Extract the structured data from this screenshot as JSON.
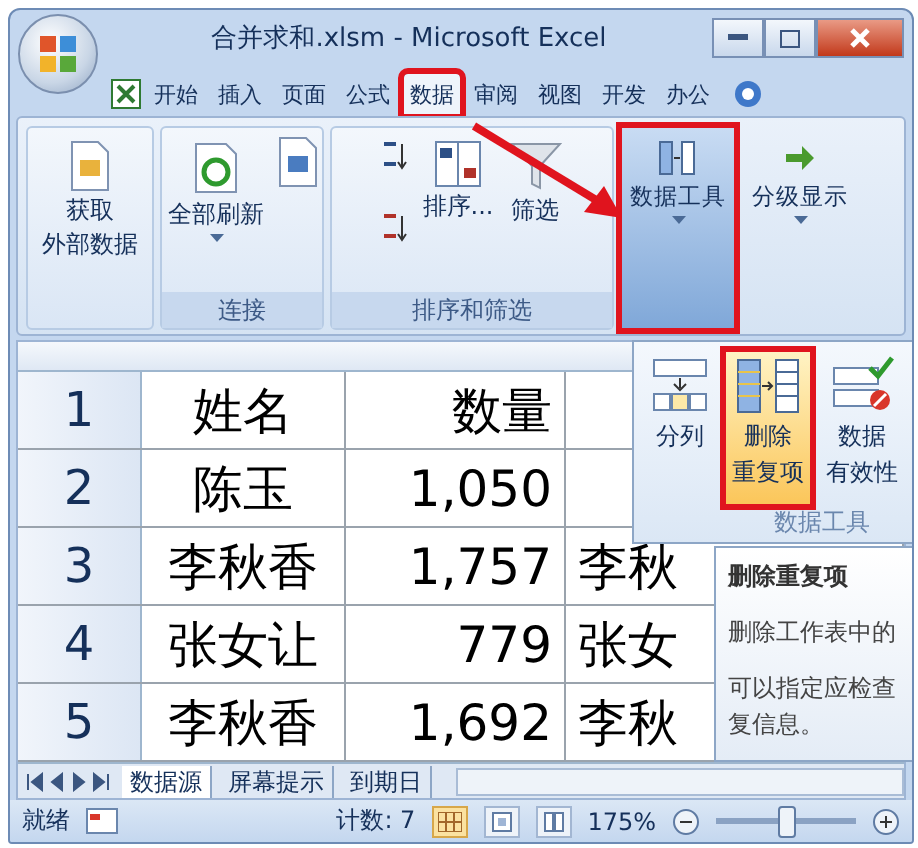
{
  "window": {
    "title": "合并求和.xlsm - Microsoft Excel"
  },
  "ribbon_tabs": [
    {
      "label": "开始",
      "selected": false,
      "highlighted": false
    },
    {
      "label": "插入",
      "selected": false,
      "highlighted": false
    },
    {
      "label": "页面",
      "selected": false,
      "highlighted": false
    },
    {
      "label": "公式",
      "selected": false,
      "highlighted": false
    },
    {
      "label": "数据",
      "selected": true,
      "highlighted": true
    },
    {
      "label": "审阅",
      "selected": false,
      "highlighted": false
    },
    {
      "label": "视图",
      "selected": false,
      "highlighted": false
    },
    {
      "label": "开发",
      "selected": false,
      "highlighted": false
    },
    {
      "label": "办公",
      "selected": false,
      "highlighted": false
    }
  ],
  "ribbon": {
    "external_data": {
      "lines": [
        "获取",
        "外部数据"
      ]
    },
    "connections": {
      "label": "连接",
      "refresh": "全部刷新"
    },
    "sort_filter": {
      "label": "排序和筛选",
      "sort": "排序...",
      "filter": "筛选"
    },
    "data_tools": {
      "label": "数据工具",
      "selected": true,
      "highlighted": true
    },
    "outline": {
      "label": "分级显示"
    }
  },
  "data_tools_popup": {
    "group_label": "数据工具",
    "buttons": [
      {
        "kind": "split",
        "lines": [
          "分列"
        ],
        "selected": false,
        "highlighted": false
      },
      {
        "kind": "dedupe",
        "lines": [
          "删除",
          "重复项"
        ],
        "selected": true,
        "highlighted": true
      },
      {
        "kind": "validation",
        "lines": [
          "数据",
          "有效性"
        ],
        "selected": false,
        "highlighted": false
      }
    ]
  },
  "tooltip": {
    "title": "删除重复项",
    "paragraphs": [
      "删除工作表中的",
      "可以指定应检查复信息。"
    ]
  },
  "sheet": {
    "rows": [
      {
        "number": "1",
        "cells": [
          "姓名",
          "数量"
        ]
      },
      {
        "number": "2",
        "cells": [
          "陈玉",
          "1,050"
        ]
      },
      {
        "number": "3",
        "cells": [
          "李秋香",
          "1,757",
          "李秋"
        ]
      },
      {
        "number": "4",
        "cells": [
          "张女让",
          "779",
          "张女"
        ]
      },
      {
        "number": "5",
        "cells": [
          "李秋香",
          "1,692",
          "李秋"
        ]
      }
    ]
  },
  "sheet_tabs": [
    {
      "label": "数据源",
      "selected": true
    },
    {
      "label": "屏幕提示",
      "selected": false
    },
    {
      "label": "到期日",
      "selected": false
    }
  ],
  "status_bar": {
    "ready": "就绪",
    "count": "计数: 7",
    "views": [
      {
        "kind": "normal",
        "selected": true
      },
      {
        "kind": "layout",
        "selected": false
      },
      {
        "kind": "break",
        "selected": false
      }
    ],
    "zoom": "175%",
    "zoom_slider": {
      "level": 0.5
    }
  }
}
